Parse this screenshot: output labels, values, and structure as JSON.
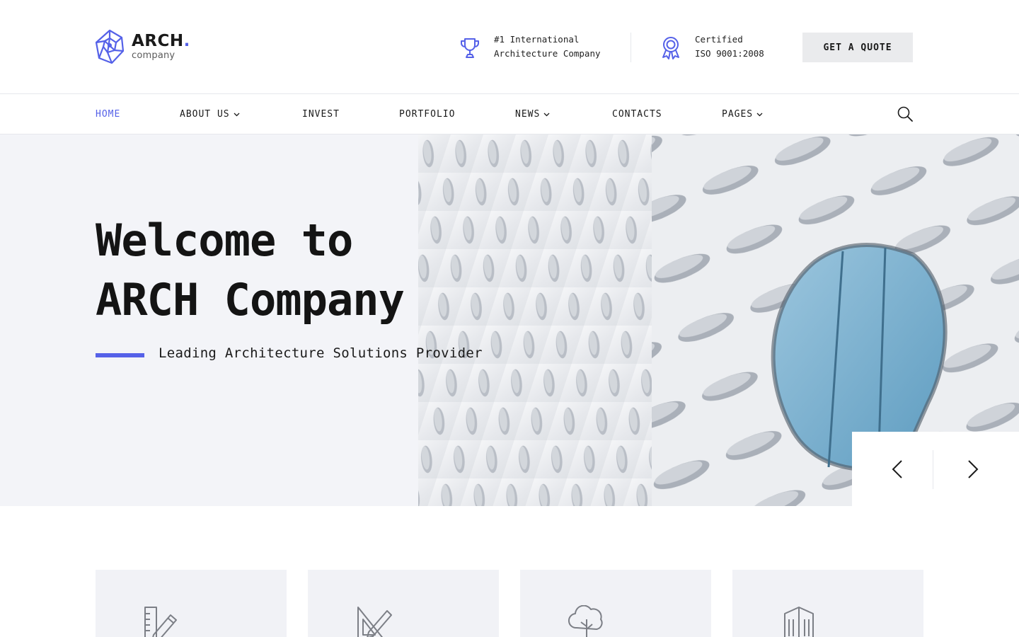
{
  "brand": {
    "name": "ARCH",
    "dot": ".",
    "tagline": "company",
    "accent_color": "#5561e8",
    "logo_icon": "geodesic-sphere-icon"
  },
  "header_info": [
    {
      "icon": "trophy-icon",
      "line1": "#1 International",
      "line2": "Architecture Company"
    },
    {
      "icon": "award-ribbon-icon",
      "line1": "Certified",
      "line2": "ISO 9001:2008"
    }
  ],
  "quote_button": {
    "label": "GET A QUOTE"
  },
  "nav": {
    "items": [
      {
        "label": "HOME",
        "active": true,
        "dropdown": false
      },
      {
        "label": "ABOUT US",
        "active": false,
        "dropdown": true
      },
      {
        "label": "INVEST",
        "active": false,
        "dropdown": false
      },
      {
        "label": "PORTFOLIO",
        "active": false,
        "dropdown": false
      },
      {
        "label": "NEWS",
        "active": false,
        "dropdown": true
      },
      {
        "label": "CONTACTS",
        "active": false,
        "dropdown": false
      },
      {
        "label": "PAGES",
        "active": false,
        "dropdown": true
      }
    ],
    "search_icon": "search-icon"
  },
  "hero": {
    "title_line1": "Welcome to",
    "title_line2": "ARCH Company",
    "subtitle": "Leading Architecture Solutions Provider",
    "image": "white-perforated-building-facade",
    "prev_icon": "chevron-left-icon",
    "next_icon": "chevron-right-icon"
  },
  "feature_cards": [
    {
      "icon": "pencil-ruler-icon"
    },
    {
      "icon": "drafting-tools-icon"
    },
    {
      "icon": "tree-icon"
    },
    {
      "icon": "office-building-icon"
    }
  ]
}
